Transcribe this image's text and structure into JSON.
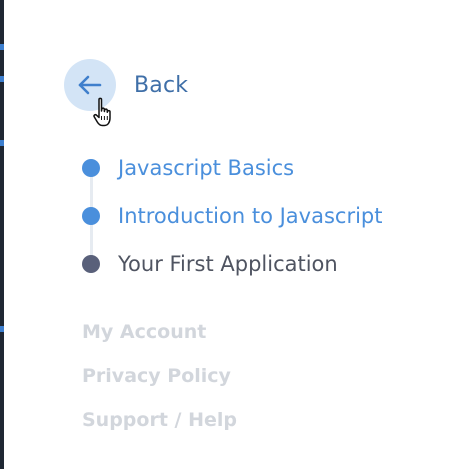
{
  "back": {
    "label": "Back",
    "icon": "arrow-left-icon"
  },
  "cursor": {
    "icon": "hand-pointer-icon"
  },
  "steps": [
    {
      "label": "Javascript Basics",
      "status": "done"
    },
    {
      "label": "Introduction to Javascript",
      "status": "done"
    },
    {
      "label": "Your First Application",
      "status": "current"
    }
  ],
  "footer_links": [
    {
      "label": "My Account"
    },
    {
      "label": "Privacy Policy"
    },
    {
      "label": "Support / Help"
    }
  ],
  "colors": {
    "accent": "#4a8fdc",
    "back_circle": "#d3e4f6",
    "back_text": "#3f6fa8",
    "current_dot": "#59607a",
    "current_text": "#4f5461",
    "muted_link": "#d2d6dc"
  }
}
